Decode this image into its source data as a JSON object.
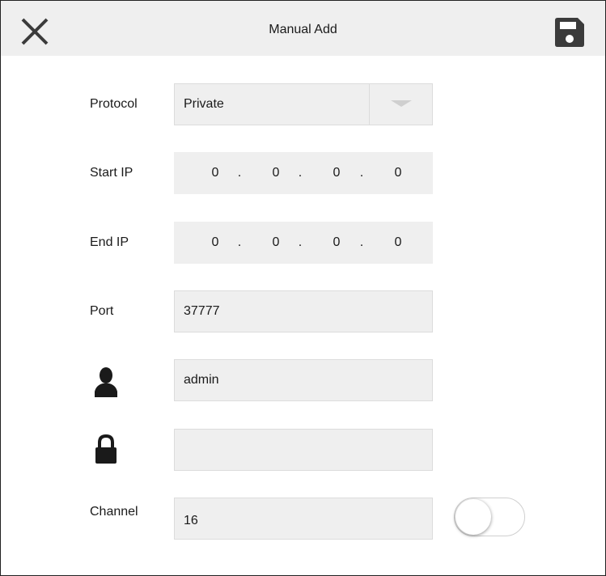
{
  "header": {
    "title": "Manual Add",
    "close_icon": "close-icon",
    "save_icon": "save-icon"
  },
  "form": {
    "protocol": {
      "label": "Protocol",
      "value": "Private"
    },
    "start_ip": {
      "label": "Start IP",
      "octets": [
        "0",
        "0",
        "0",
        "0"
      ],
      "separator": "."
    },
    "end_ip": {
      "label": "End IP",
      "octets": [
        "0",
        "0",
        "0",
        "0"
      ],
      "separator": "."
    },
    "port": {
      "label": "Port",
      "value": "37777"
    },
    "username": {
      "icon": "user-icon",
      "value": "admin"
    },
    "password": {
      "icon": "lock-icon",
      "value": ""
    },
    "channel": {
      "label": "Channel",
      "value": "16",
      "toggle_on": false
    }
  },
  "colors": {
    "header_bg": "#efefef",
    "field_bg": "#efefef",
    "icon_dark": "#3b3b3b"
  }
}
